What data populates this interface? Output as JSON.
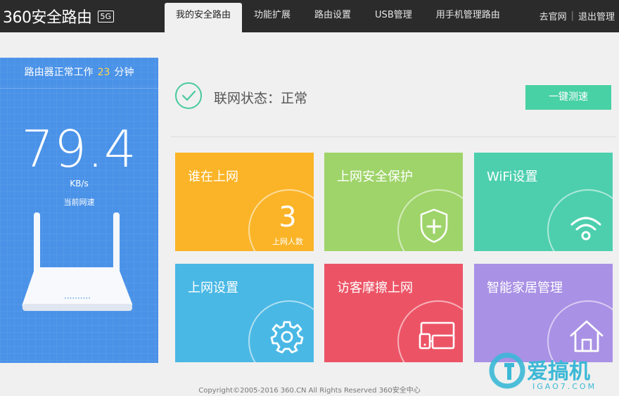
{
  "header": {
    "logo_text": "360安全路由",
    "badge": "5G",
    "tabs": [
      {
        "label": "我的安全路由",
        "active": true
      },
      {
        "label": "功能扩展"
      },
      {
        "label": "路由设置"
      },
      {
        "label": "USB管理"
      },
      {
        "label": "用手机管理路由"
      }
    ],
    "links": {
      "official_site": "去官网",
      "separator": "|",
      "logout": "退出管理"
    }
  },
  "left_panel": {
    "uptime_prefix": "路由器正常工作",
    "uptime_value": "23",
    "uptime_unit": "分钟",
    "speed_value": "79.4",
    "speed_unit": "KB/s",
    "speed_label": "当前网速",
    "router_lights": "··········"
  },
  "status": {
    "text": "联网状态：正常",
    "speed_test_button": "一键测速"
  },
  "tiles": [
    {
      "title": "谁在上网",
      "color": "#fbb427",
      "count": "3",
      "count_label": "上网人数"
    },
    {
      "title": "上网安全保护",
      "color": "#9fd46a",
      "icon": "shield-plus-icon"
    },
    {
      "title": "WiFi设置",
      "color": "#4dcfae",
      "icon": "wifi-icon"
    },
    {
      "title": "上网设置",
      "color": "#4ab8e5",
      "icon": "gear-icon"
    },
    {
      "title": "访客摩擦上网",
      "color": "#ec5466",
      "icon": "devices-icon"
    },
    {
      "title": "智能家居管理",
      "color": "#a991e5",
      "icon": "home-icon"
    }
  ],
  "footer": "Copyright©2005-2016 360.CN All Rights Reserved 360安全中心",
  "watermark": {
    "brand": "爱搞机",
    "url": "IGAO7.COM"
  }
}
